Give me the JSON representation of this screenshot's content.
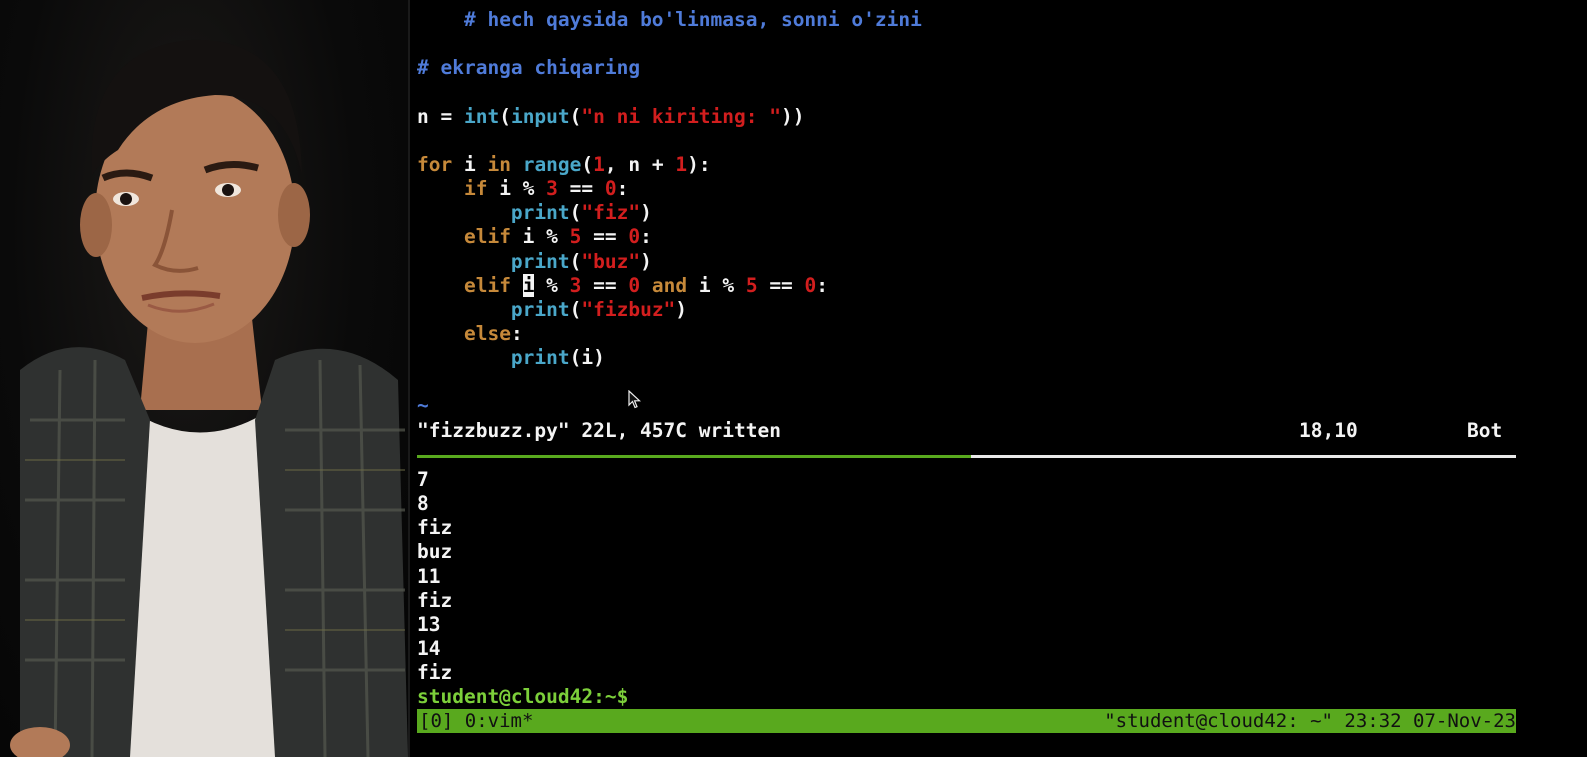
{
  "editor": {
    "lines": [
      [
        {
          "t": "    "
        },
        {
          "t": "# hech qaysida bo'linmasa, sonni o'zini",
          "c": "cmt"
        }
      ],
      [],
      [
        {
          "t": "# ekranga chiqaring",
          "c": "cmt"
        }
      ],
      [],
      [
        {
          "t": "n = "
        },
        {
          "t": "int",
          "c": "bi"
        },
        {
          "t": "("
        },
        {
          "t": "input",
          "c": "bi"
        },
        {
          "t": "("
        },
        {
          "t": "\"n ni kiriting: \"",
          "c": "str"
        },
        {
          "t": "))"
        }
      ],
      [],
      [
        {
          "t": "for",
          "c": "kw"
        },
        {
          "t": " i "
        },
        {
          "t": "in",
          "c": "kw"
        },
        {
          "t": " "
        },
        {
          "t": "range",
          "c": "bi"
        },
        {
          "t": "("
        },
        {
          "t": "1",
          "c": "num"
        },
        {
          "t": ", n + "
        },
        {
          "t": "1",
          "c": "num"
        },
        {
          "t": "):"
        }
      ],
      [
        {
          "t": "    "
        },
        {
          "t": "if",
          "c": "kw"
        },
        {
          "t": " i % "
        },
        {
          "t": "3",
          "c": "num"
        },
        {
          "t": " == "
        },
        {
          "t": "0",
          "c": "num"
        },
        {
          "t": ":"
        }
      ],
      [
        {
          "t": "        "
        },
        {
          "t": "print",
          "c": "bi"
        },
        {
          "t": "("
        },
        {
          "t": "\"fiz\"",
          "c": "str"
        },
        {
          "t": ")"
        }
      ],
      [
        {
          "t": "    "
        },
        {
          "t": "elif",
          "c": "kw"
        },
        {
          "t": " i % "
        },
        {
          "t": "5",
          "c": "num"
        },
        {
          "t": " == "
        },
        {
          "t": "0",
          "c": "num"
        },
        {
          "t": ":"
        }
      ],
      [
        {
          "t": "        "
        },
        {
          "t": "print",
          "c": "bi"
        },
        {
          "t": "("
        },
        {
          "t": "\"buz\"",
          "c": "str"
        },
        {
          "t": ")"
        }
      ],
      [
        {
          "t": "    "
        },
        {
          "t": "elif",
          "c": "kw"
        },
        {
          "t": " "
        },
        {
          "t": "i",
          "c": "cursor"
        },
        {
          "t": " % "
        },
        {
          "t": "3",
          "c": "num"
        },
        {
          "t": " == "
        },
        {
          "t": "0",
          "c": "num"
        },
        {
          "t": " "
        },
        {
          "t": "and",
          "c": "kw"
        },
        {
          "t": " i % "
        },
        {
          "t": "5",
          "c": "num"
        },
        {
          "t": " == "
        },
        {
          "t": "0",
          "c": "num"
        },
        {
          "t": ":"
        }
      ],
      [
        {
          "t": "        "
        },
        {
          "t": "print",
          "c": "bi"
        },
        {
          "t": "("
        },
        {
          "t": "\"fizbuz\"",
          "c": "str"
        },
        {
          "t": ")"
        }
      ],
      [
        {
          "t": "    "
        },
        {
          "t": "else",
          "c": "kw"
        },
        {
          "t": ":"
        }
      ],
      [
        {
          "t": "        "
        },
        {
          "t": "print",
          "c": "bi"
        },
        {
          "t": "(i)"
        }
      ],
      [],
      [
        {
          "t": "~",
          "c": "tilde"
        }
      ]
    ],
    "status_message": "\"fizzbuzz.py\" 22L, 457C written",
    "cursor_position": "18,10",
    "scroll_position": "Bot"
  },
  "shell": {
    "output_lines": [
      "7",
      "8",
      "fiz",
      "buz",
      "11",
      "fiz",
      "13",
      "14",
      "fiz"
    ],
    "prompt": "student@cloud42:~$"
  },
  "tmux": {
    "session_windows": "[0] 0:vim*",
    "status_right": "\"student@cloud42: ~\" 23:32 07-Nov-23"
  },
  "colors": {
    "comment": "#4f7bd9",
    "keyword": "#c6893a",
    "builtin": "#4aa7c9",
    "string_number": "#d21e1e",
    "tmux_bar": "#59a91e",
    "prompt": "#7ccf3a"
  }
}
